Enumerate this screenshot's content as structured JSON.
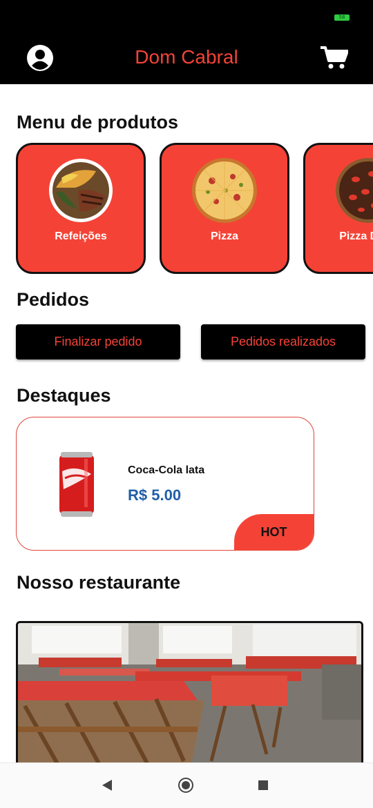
{
  "status_bar": {
    "battery": "58"
  },
  "app_bar": {
    "title": "Dom Cabral",
    "left_icon": "profile-icon",
    "right_icon": "cart-icon"
  },
  "menu": {
    "title": "Menu de produtos",
    "categories": [
      {
        "label": "Refeições",
        "icon": "meal-plate-image"
      },
      {
        "label": "Pizza",
        "icon": "pizza-image"
      },
      {
        "label": "Pizza Doce",
        "icon": "sweet-pizza-image"
      }
    ]
  },
  "orders": {
    "title": "Pedidos",
    "finish_label": "Finalizar pedido",
    "history_label": "Pedidos realizados"
  },
  "highlights": {
    "title": "Destaques",
    "item": {
      "name": "Coca-Cola lata",
      "price": "R$ 5.00",
      "badge": "HOT"
    }
  },
  "restaurant": {
    "title": "Nosso restaurante"
  },
  "colors": {
    "accent": "#f44336",
    "bar": "#000000",
    "price": "#1f5fa8"
  }
}
